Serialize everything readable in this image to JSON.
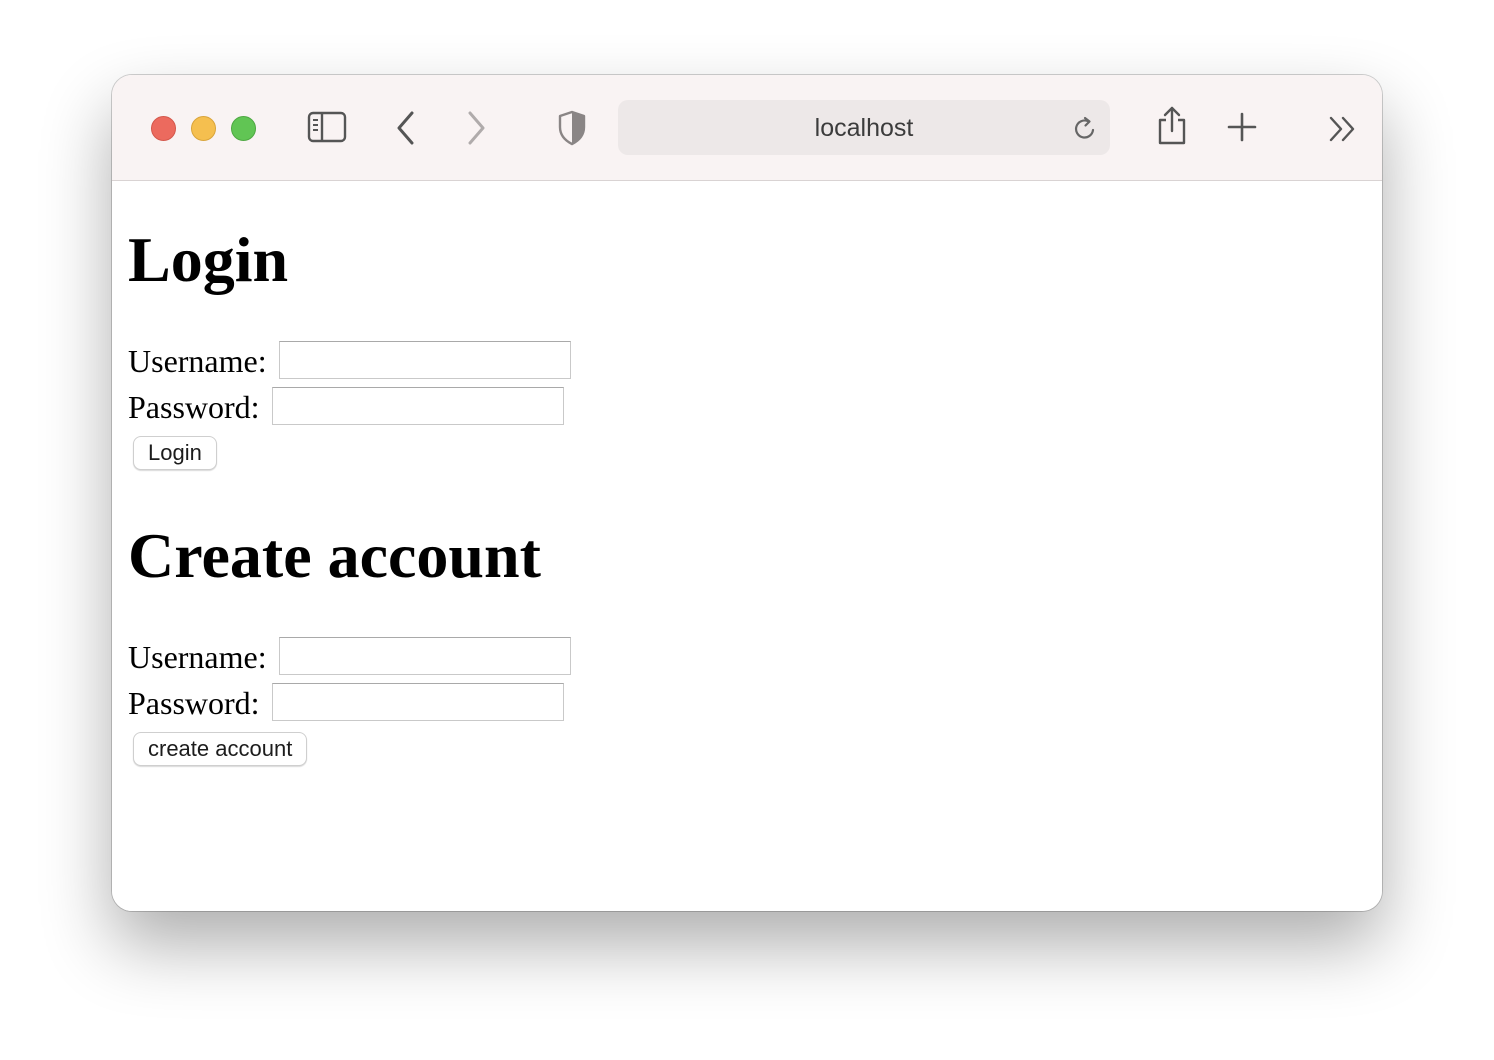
{
  "browser": {
    "url": "localhost"
  },
  "login": {
    "heading": "Login",
    "username_label": "Username:",
    "password_label": "Password:",
    "username_value": "",
    "password_value": "",
    "submit_label": "Login"
  },
  "create_account": {
    "heading": "Create account",
    "username_label": "Username:",
    "password_label": "Password:",
    "username_value": "",
    "password_value": "",
    "submit_label": "create account"
  }
}
